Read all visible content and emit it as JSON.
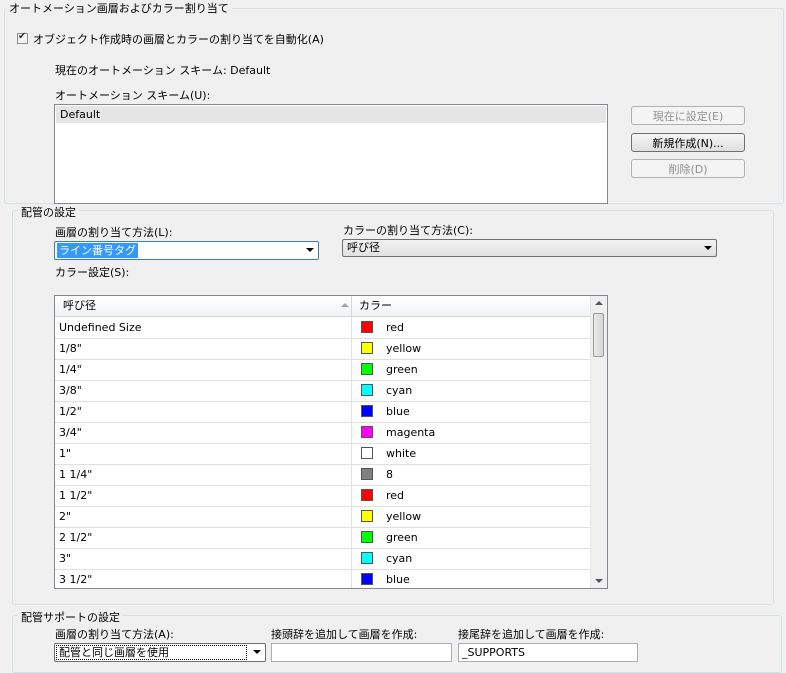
{
  "automation": {
    "group_title": "オートメーション画層およびカラー割り当て",
    "auto_checkbox_label": "オブジェクト作成時の画層とカラーの割り当てを自動化(A)",
    "auto_checked": true,
    "current_scheme_label": "現在のオートメーション スキーム: Default",
    "scheme_list_label": "オートメーション スキーム(U):",
    "schemes": [
      "Default"
    ],
    "btn_set_current": "現在に設定(E)",
    "btn_new": "新規作成(N)...",
    "btn_delete": "削除(D)"
  },
  "pipe": {
    "group_title": "配管の設定",
    "layer_method_label": "画層の割り当て方法(L):",
    "layer_method_value": "ライン番号タグ",
    "color_method_label": "カラーの割り当て方法(C):",
    "color_method_value": "呼び径",
    "color_settings_label": "カラー設定(S):",
    "col_size": "呼び径",
    "col_color": "カラー",
    "rows": [
      {
        "size": "Undefined Size",
        "color": "red",
        "hex": "#ff0000"
      },
      {
        "size": "1/8\"",
        "color": "yellow",
        "hex": "#ffff00"
      },
      {
        "size": "1/4\"",
        "color": "green",
        "hex": "#00ff00"
      },
      {
        "size": "3/8\"",
        "color": "cyan",
        "hex": "#00ffff"
      },
      {
        "size": "1/2\"",
        "color": "blue",
        "hex": "#0000ff"
      },
      {
        "size": "3/4\"",
        "color": "magenta",
        "hex": "#ff00ff"
      },
      {
        "size": "1\"",
        "color": "white",
        "hex": "#ffffff"
      },
      {
        "size": "1 1/4\"",
        "color": "8",
        "hex": "#808080"
      },
      {
        "size": "1 1/2\"",
        "color": "red",
        "hex": "#ff0000"
      },
      {
        "size": "2\"",
        "color": "yellow",
        "hex": "#ffff00"
      },
      {
        "size": "2 1/2\"",
        "color": "green",
        "hex": "#00ff00"
      },
      {
        "size": "3\"",
        "color": "cyan",
        "hex": "#00ffff"
      },
      {
        "size": "3 1/2\"",
        "color": "blue",
        "hex": "#0000ff"
      }
    ]
  },
  "support": {
    "group_title": "配管サポートの設定",
    "layer_method_label": "画層の割り当て方法(A):",
    "layer_method_value": "配管と同じ画層を使用",
    "prefix_label": "接頭辞を追加して画層を作成:",
    "prefix_value": "",
    "suffix_label": "接尾辞を追加して画層を作成:",
    "suffix_value": "_SUPPORTS"
  }
}
